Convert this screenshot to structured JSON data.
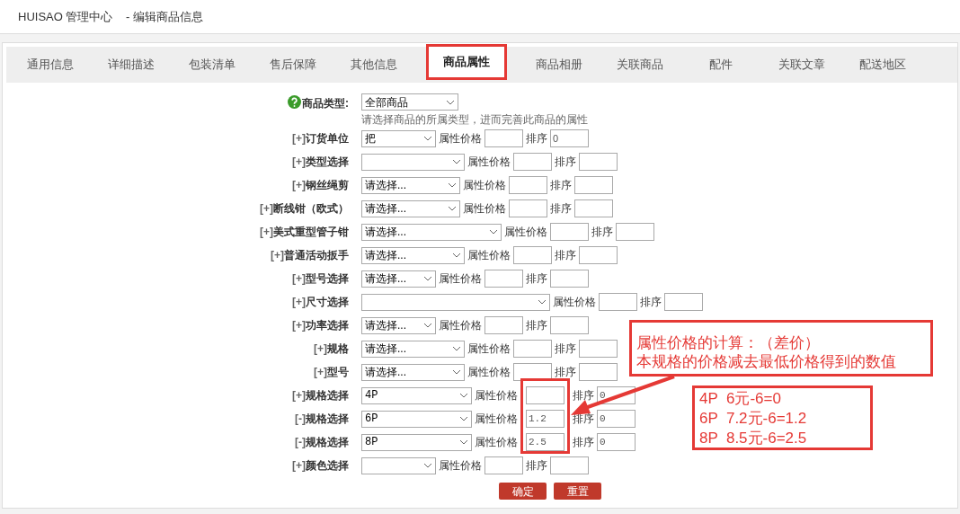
{
  "header": {
    "brand": "HUISAO 管理中心",
    "page_title": "- 编辑商品信息"
  },
  "tabs": [
    {
      "label": "通用信息",
      "selected": false
    },
    {
      "label": "详细描述",
      "selected": false
    },
    {
      "label": "包装清单",
      "selected": false
    },
    {
      "label": "售后保障",
      "selected": false
    },
    {
      "label": "其他信息",
      "selected": false
    },
    {
      "label": "商品属性",
      "selected": true
    },
    {
      "label": "商品相册",
      "selected": false
    },
    {
      "label": "关联商品",
      "selected": false
    },
    {
      "label": "配件",
      "selected": false
    },
    {
      "label": "关联文章",
      "selected": false
    },
    {
      "label": "配送地区",
      "selected": false
    }
  ],
  "product_type": {
    "label": "商品类型:",
    "value": "全部商品",
    "hint": "请选择商品的所属类型，进而完善此商品的属性"
  },
  "attributes": [
    {
      "kind": "plain",
      "toggle": "[+]",
      "label": "订货单位",
      "value": "把",
      "price_label": "属性价格",
      "sort_label": "排序",
      "sort": "0"
    },
    {
      "kind": "plain",
      "toggle": "[+]",
      "label": "类型选择",
      "price_label": "属性价格",
      "sort_label": "排序"
    },
    {
      "kind": "plain",
      "toggle": "[+]",
      "label": "钢丝绳剪",
      "value": "请选择...",
      "price_label": "属性价格",
      "sort_label": "排序"
    },
    {
      "kind": "plain",
      "toggle": "[+]",
      "label": "断线钳（欧式）",
      "value": "请选择...",
      "price_label": "属性价格",
      "sort_label": "排序"
    },
    {
      "kind": "plain",
      "toggle": "[+]",
      "label": "美式重型管子钳",
      "value": "请选择...",
      "price_label": "属性价格",
      "sort_label": "排序"
    },
    {
      "kind": "plain",
      "toggle": "[+]",
      "label": "普通活动扳手",
      "value": "请选择...",
      "price_label": "属性价格",
      "sort_label": "排序"
    },
    {
      "kind": "plain",
      "toggle": "[+]",
      "label": "型号选择",
      "value": "请选择...",
      "price_label": "属性价格",
      "sort_label": "排序"
    },
    {
      "kind": "plain",
      "toggle": "[+]",
      "label": "尺寸选择",
      "price_label": "属性价格",
      "sort_label": "排序"
    },
    {
      "kind": "plain",
      "toggle": "[+]",
      "label": "功率选择",
      "value": "请选择...",
      "price_label": "属性价格",
      "sort_label": "排序"
    },
    {
      "kind": "plain",
      "toggle": "[+]",
      "label": "规格",
      "value": "请选择...",
      "price_label": "属性价格",
      "sort_label": "排序"
    },
    {
      "kind": "plain",
      "toggle": "[+]",
      "label": "型号",
      "value": "请选择...",
      "price_label": "属性价格",
      "sort_label": "排序"
    },
    {
      "kind": "spec",
      "toggle": "[+]",
      "label": "规格选择",
      "value": "4P",
      "price_label": "属性价格",
      "sort_label": "排序",
      "sort": "0"
    },
    {
      "kind": "spec",
      "toggle": "[-]",
      "label": "规格选择",
      "value": "6P",
      "price_label": "属性价格",
      "price": "1.2",
      "sort_label": "排序",
      "sort": "0"
    },
    {
      "kind": "spec",
      "toggle": "[-]",
      "label": "规格选择",
      "value": "8P",
      "price_label": "属性价格",
      "price": "2.5",
      "sort_label": "排序",
      "sort": "0"
    },
    {
      "kind": "plain",
      "toggle": "[+]",
      "label": "颜色选择",
      "price_label": "属性价格",
      "sort_label": "排序"
    }
  ],
  "buttons": [
    "确定",
    "重置"
  ],
  "annotations": {
    "note_lines": [
      "属性价格的计算：（差价）",
      "本规格的价格减去最低价格得到的数值"
    ],
    "examples": [
      "4P  6元-6=0",
      "6P  7.2元-6=1.2",
      "8P  8.5元-6=2.5"
    ]
  }
}
